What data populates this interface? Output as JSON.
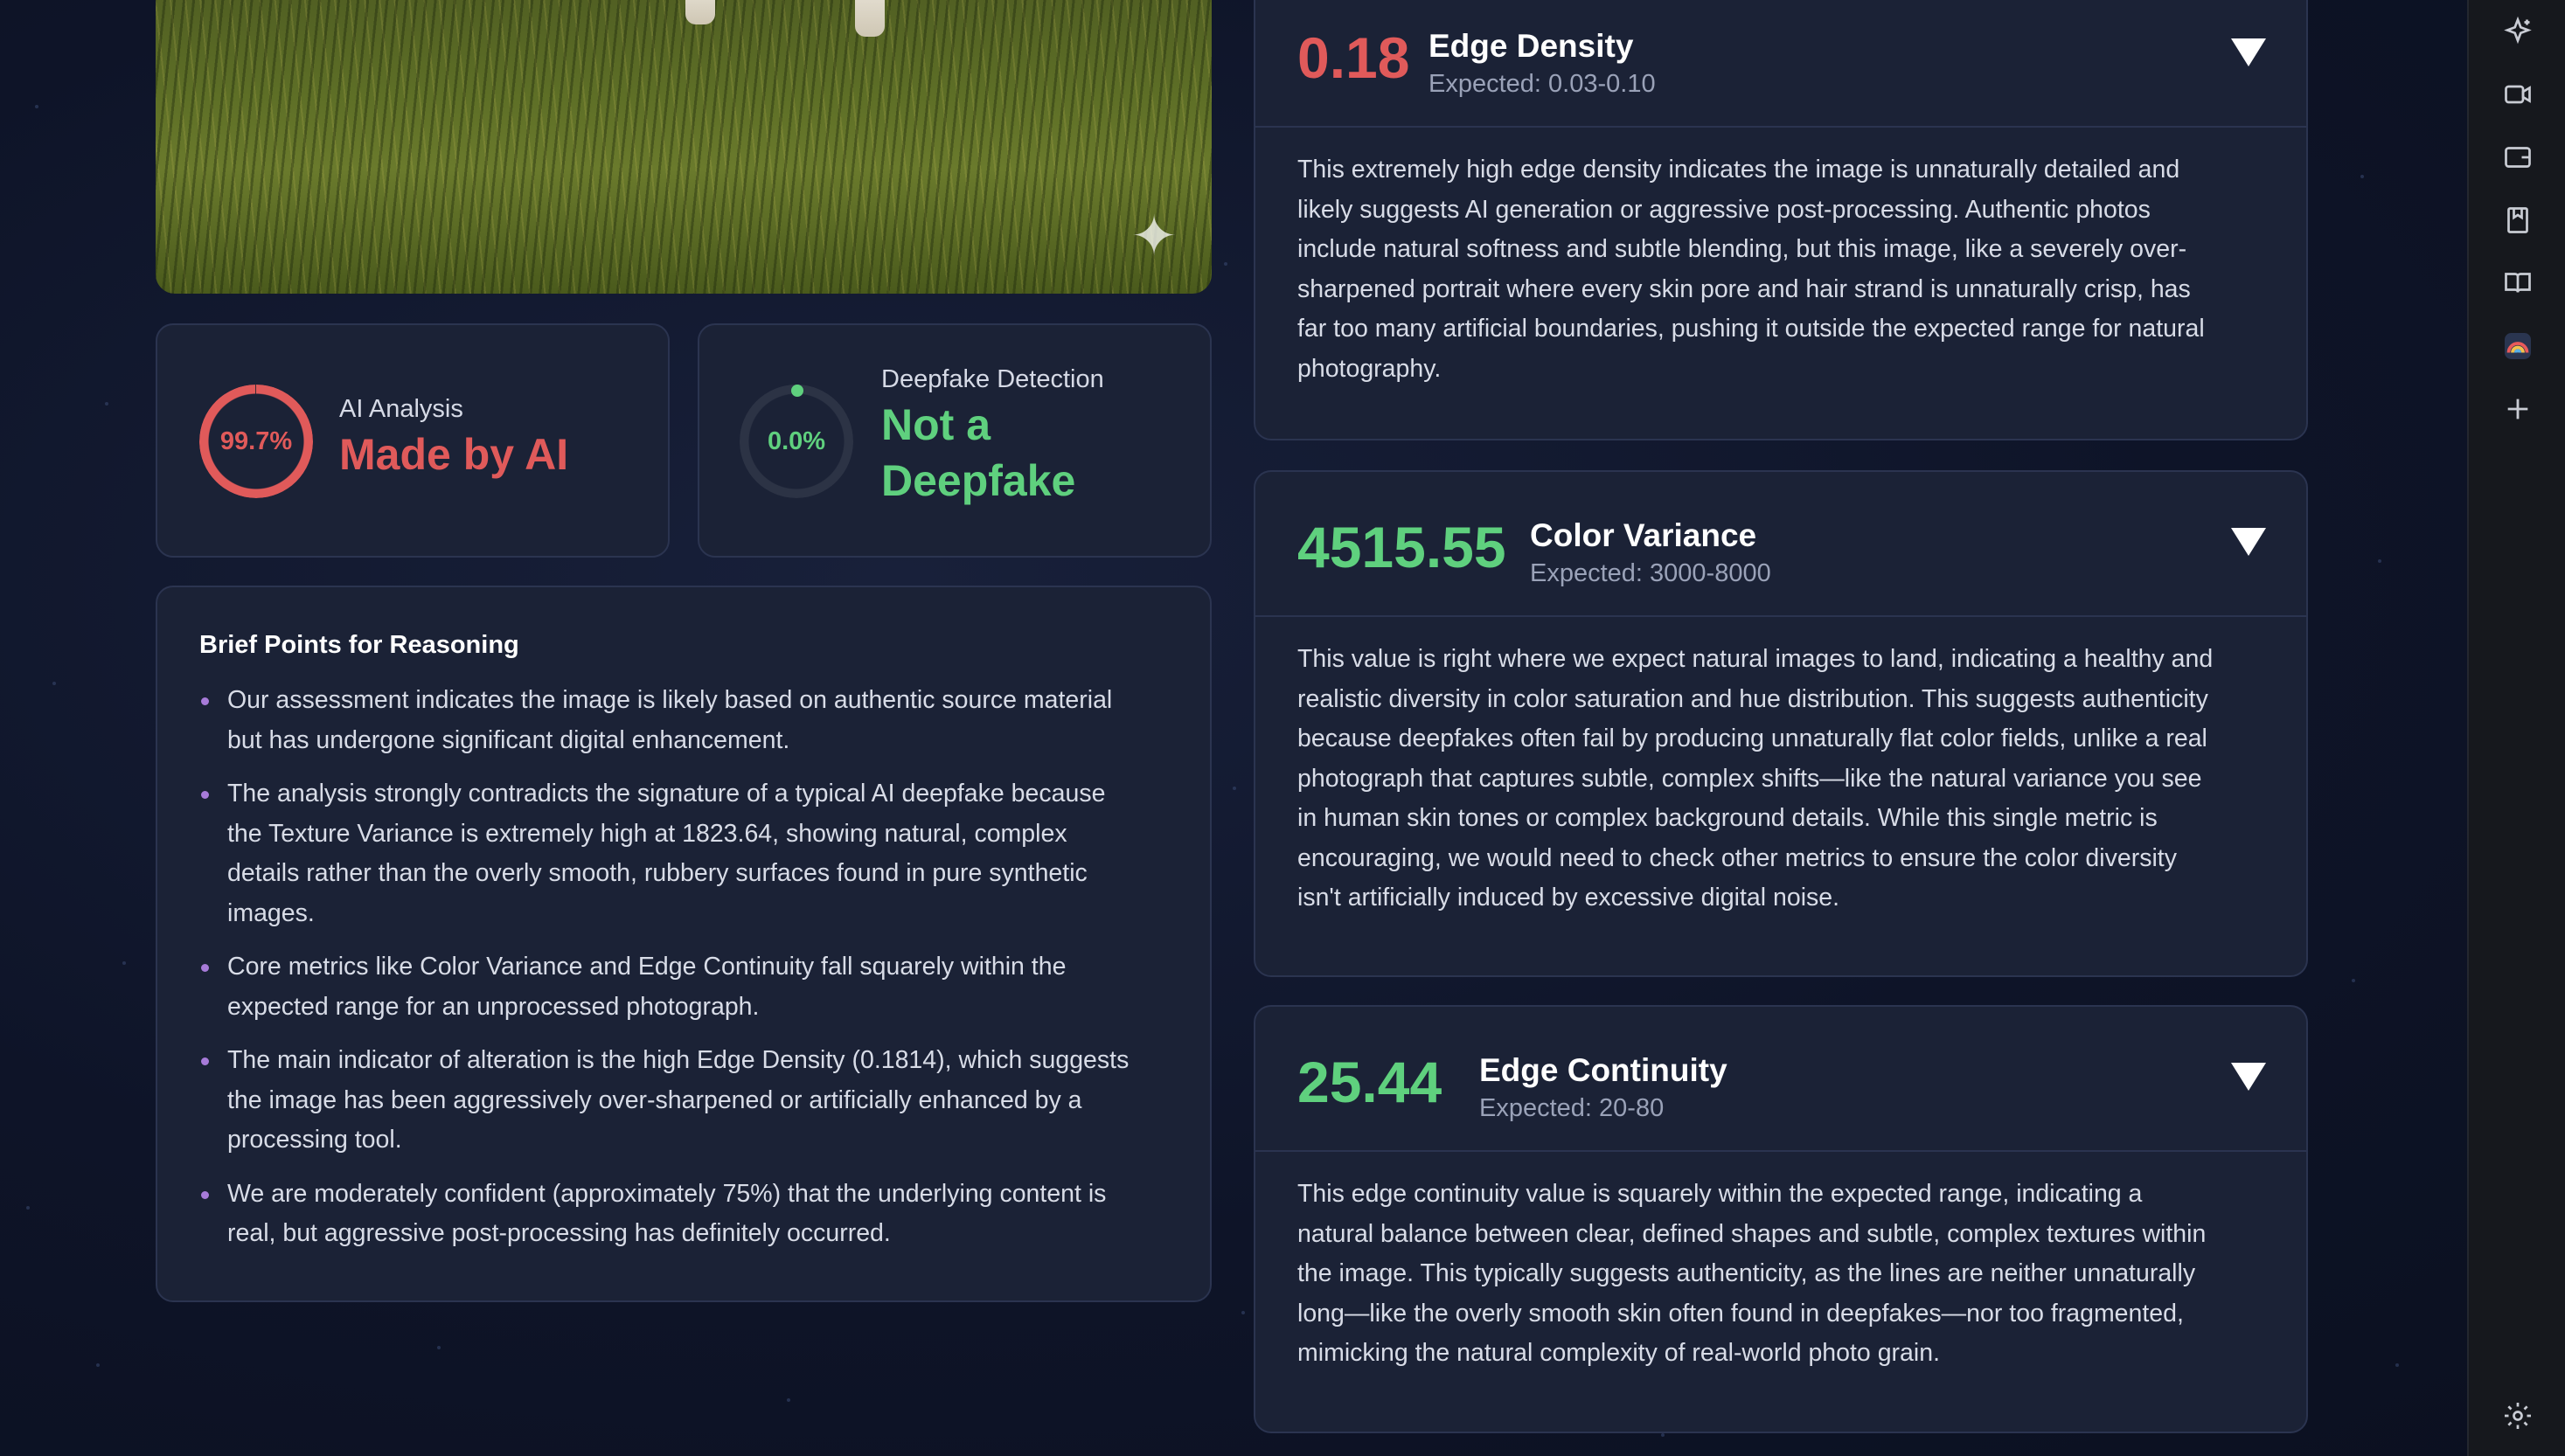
{
  "ai_card": {
    "percent": "99.7%",
    "percent_value": 0.997,
    "caption": "AI Analysis",
    "verdict": "Made by AI",
    "color": "#e05a5a"
  },
  "deepfake_card": {
    "percent": "0.0%",
    "percent_value": 0.0,
    "caption": "Deepfake Detection",
    "verdict_line1": "Not a",
    "verdict_line2": "Deepfake",
    "color": "#5fd07e"
  },
  "reasoning": {
    "title": "Brief Points for Reasoning",
    "points": [
      {
        "lines": [
          "Our assessment indicates the image is likely based on authentic source material",
          "but has undergone significant digital enhancement."
        ]
      },
      {
        "lines": [
          "The analysis strongly contradicts the signature of a typical AI deepfake because",
          "the Texture Variance is extremely high at 1823.64, showing natural, complex",
          "details rather than the overly smooth, rubbery surfaces found in pure synthetic",
          "images."
        ]
      },
      {
        "lines": [
          "Core metrics like Color Variance and Edge Continuity fall squarely within the",
          "expected range for an unprocessed photograph."
        ]
      },
      {
        "lines": [
          "The main indicator of alteration is the high Edge Density (0.1814), which suggests",
          "the image has been aggressively over-sharpened or artificially enhanced by a",
          "processing tool."
        ]
      },
      {
        "lines": [
          "We are moderately confident (approximately 75%) that the underlying content is",
          "real, but aggressive post-processing has definitely occurred."
        ]
      }
    ]
  },
  "metrics": [
    {
      "value": "0.18",
      "title": "Edge Density",
      "expected": "Expected: 0.03-0.10",
      "status_color": "#e05a5a",
      "lines": [
        "This extremely high edge density indicates the image is unnaturally detailed and",
        "likely suggests AI generation or aggressive post-processing. Authentic photos",
        "include natural softness and subtle blending, but this image, like a severely over-",
        "sharpened portrait where every skin pore and hair strand is unnaturally crisp, has",
        "far too many artificial boundaries, pushing it outside the expected range for natural",
        "photography."
      ]
    },
    {
      "value": "4515.55",
      "title": "Color Variance",
      "expected": "Expected: 3000-8000",
      "status_color": "#5fd07e",
      "lines": [
        "This value is right where we expect natural images to land, indicating a healthy and",
        "realistic diversity in color saturation and hue distribution. This suggests authenticity",
        "because deepfakes often fail by producing unnaturally flat color fields, unlike a real",
        "photograph that captures subtle, complex shifts—like the natural variance you see",
        "in human skin tones or complex background details. While this single metric is",
        "encouraging, we would need to check other metrics to ensure the color diversity",
        "isn't artificially induced by excessive digital noise."
      ]
    },
    {
      "value": "25.44",
      "title": "Edge Continuity",
      "expected": "Expected: 20-80",
      "status_color": "#5fd07e",
      "lines": [
        "This edge continuity value is squarely within the expected range, indicating a",
        "natural balance between clear, defined shapes and subtle, complex textures within",
        "the image. This typically suggests authenticity, as the lines are neither unnaturally",
        "long—like the overly smooth skin often found in deepfakes—nor too fragmented,",
        "mimicking the natural complexity of real-world photo grain."
      ]
    }
  ],
  "sidebar_icons": [
    "sparkle-icon",
    "video-icon",
    "wallet-icon",
    "bookmark-icon",
    "reading-list-icon",
    "rainbow-app-icon",
    "add-icon",
    "settings-icon"
  ]
}
